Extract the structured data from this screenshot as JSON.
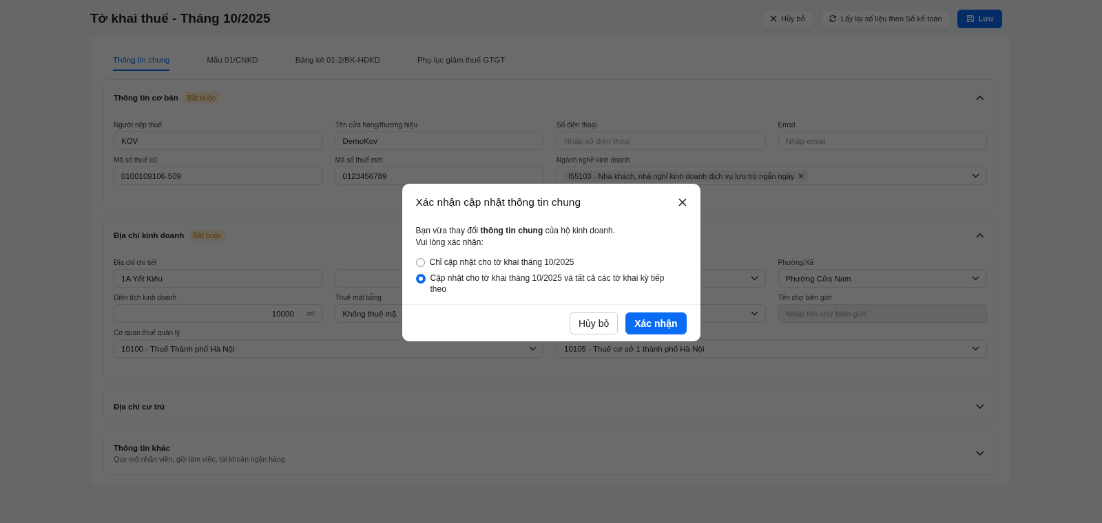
{
  "header": {
    "title": "Tờ khai thuế - Tháng 10/2025",
    "buttons": [
      {
        "label": "Hủy bỏ",
        "kind": "ghost"
      },
      {
        "label": "Lấy lại số liệu theo Sổ kế toán",
        "kind": "ghost"
      },
      {
        "label": "Lưu",
        "kind": "primary"
      }
    ]
  },
  "tabs": [
    {
      "label": "Thông tin chung",
      "selected": true
    },
    {
      "label": "Mẫu 01/CNKD",
      "selected": false
    },
    {
      "label": "Bảng kê 01-2/BK-HĐKD",
      "selected": false
    },
    {
      "label": "Phụ lục giảm thuế GTGT",
      "selected": false
    }
  ],
  "sections": [
    {
      "title": "Thông tin cơ bản",
      "badge": "Bắt buộc",
      "expanded": true,
      "rows": [
        [
          {
            "label": "Người nộp thuế",
            "value": "KOV",
            "kind": "text"
          },
          {
            "label": "Tên cửa hàng/thương hiệu",
            "value": "DemoKov",
            "kind": "text"
          },
          {
            "label": "Số điện thoại",
            "placeholder": "Nhập số điện thoại",
            "kind": "text"
          },
          {
            "label": "Email",
            "placeholder": "Nhập email",
            "kind": "text"
          }
        ],
        [
          {
            "label": "Mã số thuế cũ",
            "value": "0100109106-509",
            "kind": "text"
          },
          {
            "label": "Mã số thuế mới",
            "value": "0123456789",
            "kind": "text"
          },
          {
            "label": "Ngành nghề kinh doanh",
            "tags": [
              "I55103 - Nhà khách, nhà nghỉ kinh doanh dịch vụ lưu trú ngắn ngày"
            ],
            "kind": "tags",
            "wide": true
          }
        ]
      ]
    },
    {
      "title": "Địa chỉ kinh doanh",
      "badge": "Bắt buộc",
      "expanded": true,
      "rows": [
        [
          {
            "label": "Địa chỉ chi tiết",
            "value": "1A Yết Kiêu",
            "kind": "text"
          },
          {
            "kind": "box"
          },
          {
            "kind": "select"
          },
          {
            "label": "Phường/Xã",
            "value": "Phường Cửa Nam",
            "kind": "select"
          }
        ],
        [
          {
            "label": "Diện tích kinh doanh",
            "value": "10000",
            "unit": "m²",
            "kind": "unit"
          },
          {
            "label": "Thuê mặt bằng",
            "value": "Không thuê mặ",
            "kind": "box"
          },
          {
            "kind": "select"
          },
          {
            "label": "Tên chợ biên giới",
            "placeholder": "Nhập tên chợ biên giới",
            "kind": "text",
            "disabled": true
          }
        ],
        [
          {
            "label": "Cơ quan thuế quản lý",
            "value": "10100 - Thuế Thành phố Hà Nội",
            "kind": "select",
            "wide": true
          },
          {
            "value": "10105 - Thuế cơ sở 1 thành phố Hà Nội",
            "kind": "select",
            "wide": true
          }
        ]
      ]
    },
    {
      "title": "Địa chỉ cư trú",
      "expanded": false
    },
    {
      "title": "Thông tin khác",
      "subtitle": "Quy mô nhân viên, giờ làm việc, tài khoản ngân hàng",
      "expanded": false
    }
  ],
  "dialog": {
    "title": "Xác nhận cập nhật thông tin chung",
    "message": "Bạn vừa thay đổi **thông tin chung** của hộ kinh doanh.",
    "prompt": "Vui lòng xác nhận:",
    "options": [
      {
        "label": "Chỉ cập nhật cho tờ khai tháng 10/2025",
        "selected": false
      },
      {
        "label": "Cập nhật cho tờ khai tháng 10/2025 và tất cả các tờ khai kỳ tiếp theo",
        "selected": true
      }
    ],
    "buttons": [
      {
        "label": "Hủy bỏ",
        "kind": "secondary"
      },
      {
        "label": "Xác nhận",
        "kind": "primary"
      }
    ]
  }
}
